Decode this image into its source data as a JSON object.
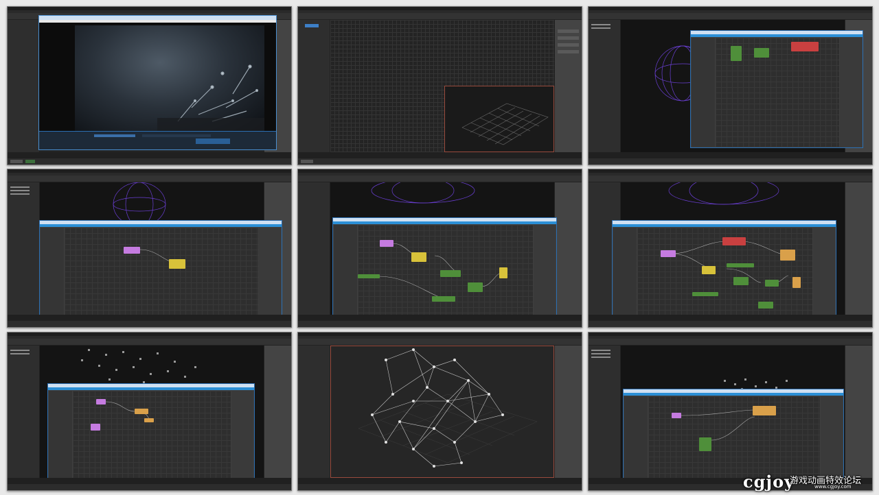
{
  "sheet": {
    "tiles": [
      {
        "id": "t1",
        "content": "video-player"
      },
      {
        "id": "t2",
        "content": "empty-viewport-grid"
      },
      {
        "id": "t3",
        "content": "node-editor-sphere"
      },
      {
        "id": "t4",
        "content": "node-editor-small-graph"
      },
      {
        "id": "t5",
        "content": "node-editor-large-graph"
      },
      {
        "id": "t6",
        "content": "node-editor-complex-graph"
      },
      {
        "id": "t7",
        "content": "particles-node-editor"
      },
      {
        "id": "t8",
        "content": "network-cloud-viewport"
      },
      {
        "id": "t9",
        "content": "particles-node-editor-2"
      }
    ]
  },
  "colors": {
    "node_purple": "#c57be0",
    "node_yellow": "#d8c23a",
    "node_green": "#4f8f3a",
    "node_red": "#c94040",
    "node_orange": "#d9a04a",
    "accent_blue": "#2b8fd6",
    "sphere_blue": "#6b3fd6"
  },
  "watermark": {
    "logo": "cgjoy",
    "chinese": "游戏动画特效论坛",
    "url": "www.cgjoy.com"
  }
}
